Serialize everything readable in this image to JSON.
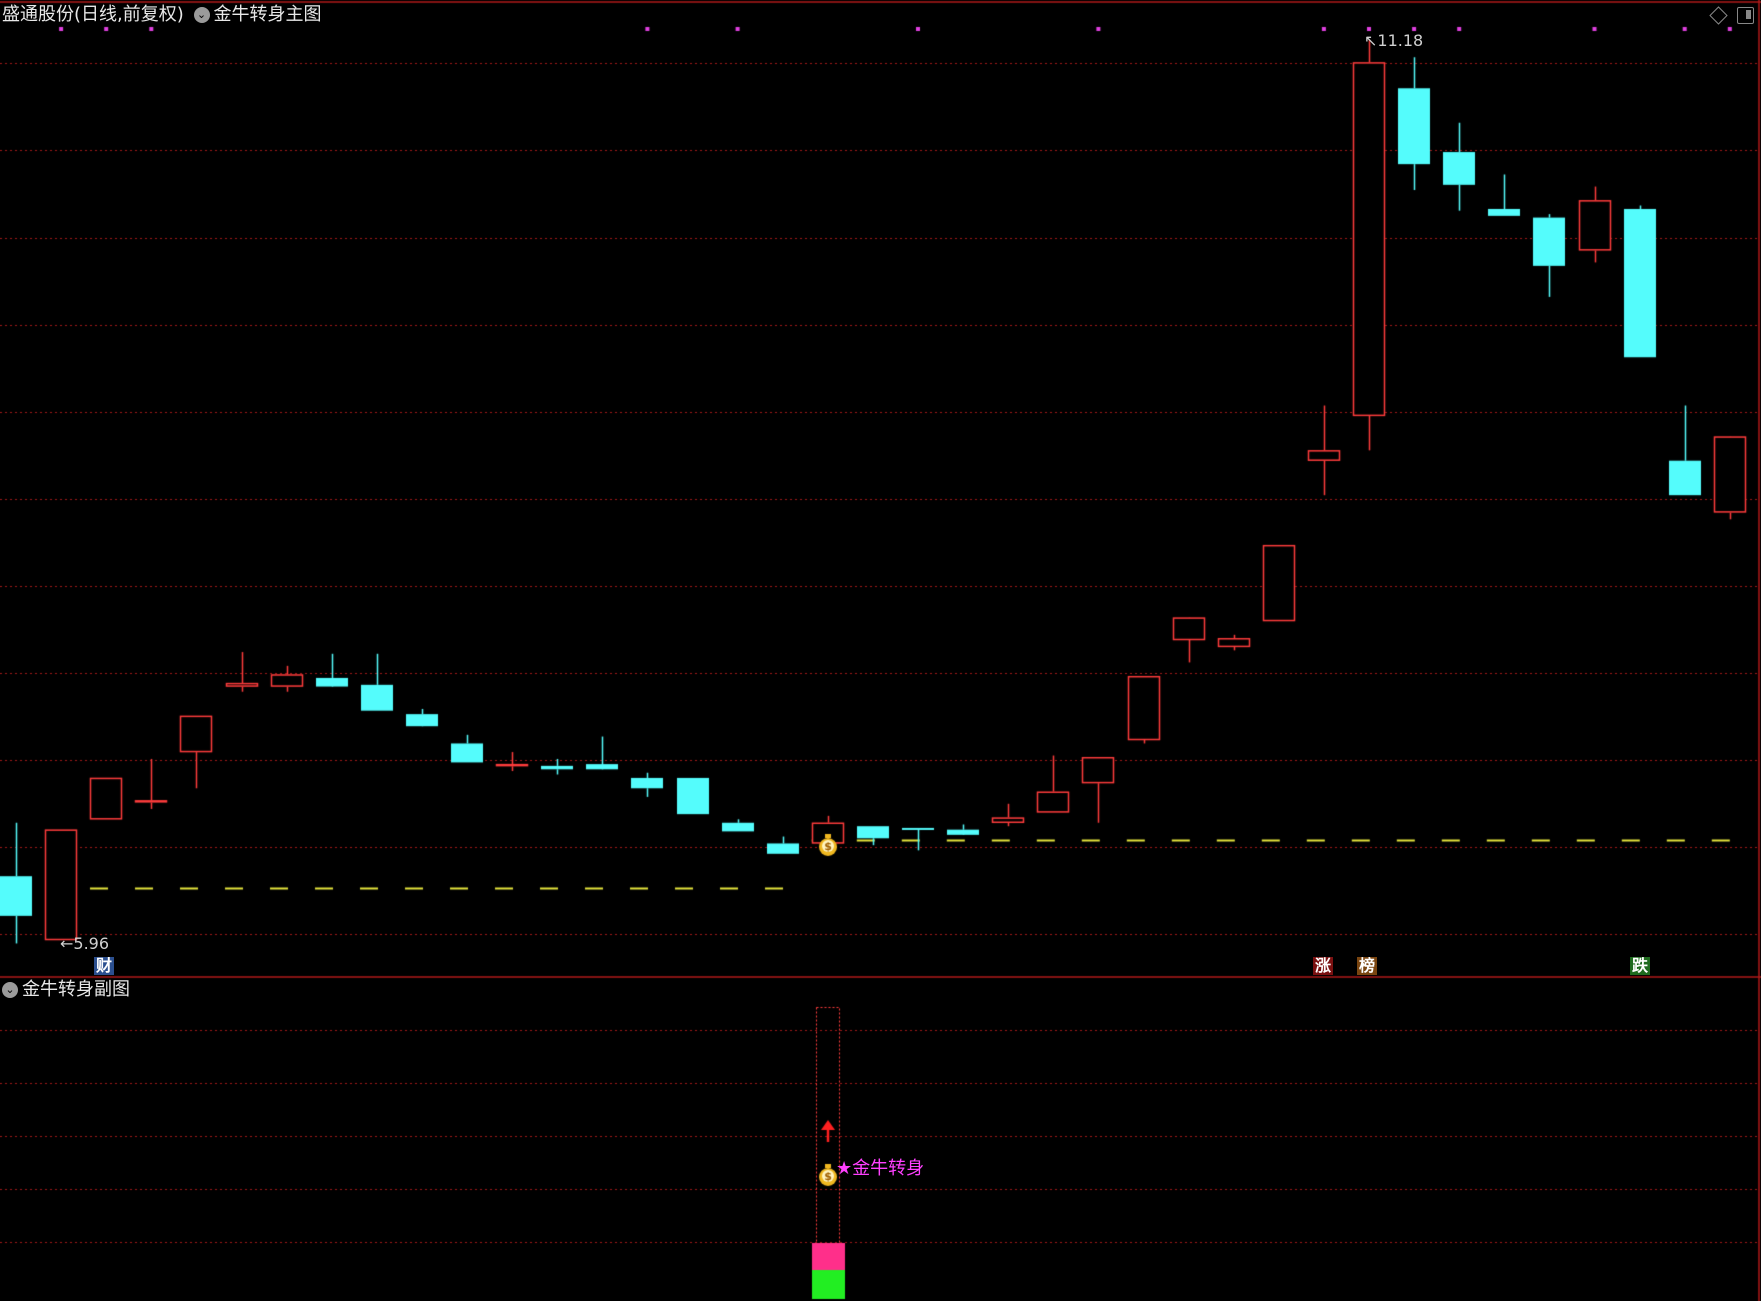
{
  "header": {
    "stock_title": "盛通股份(日线,前复权)",
    "main_indicator": "金牛转身主图",
    "sub_indicator": "金牛转身副图",
    "check_icon": "chevron-down-icon",
    "diamond_icon": "diamond-icon",
    "window_icon": "window-toggle-icon"
  },
  "labels": {
    "high_price": "11.18",
    "low_price": "5.96",
    "signal_text": "★金牛转身"
  },
  "event_markers": [
    {
      "text": "财",
      "bg": "#2b4f8f"
    },
    {
      "text": "涨",
      "bg": "#7a1010"
    },
    {
      "text": "榜",
      "bg": "#7a4510"
    },
    {
      "text": "跌",
      "bg": "#1e6a1e"
    }
  ],
  "colors": {
    "up": "#ff3c3c",
    "down": "#54fcfc",
    "grid": "#a01818",
    "support": "#e6e63c",
    "signal": "#ff40ff",
    "bar_top": "#ff2f8a",
    "bar_bottom": "#22ee22",
    "marker_dots": "#e040e0"
  },
  "chart_data": {
    "type": "candlestick",
    "price_range": [
      5.96,
      11.18
    ],
    "candles": [
      {
        "o": 6.33,
        "h": 6.64,
        "l": 5.94,
        "c": 6.1
      },
      {
        "o": 5.96,
        "h": 6.6,
        "l": 5.96,
        "c": 6.6
      },
      {
        "o": 6.66,
        "h": 6.9,
        "l": 6.66,
        "c": 6.9
      },
      {
        "o": 6.77,
        "h": 7.01,
        "l": 6.72,
        "c": 6.77
      },
      {
        "o": 7.05,
        "h": 7.26,
        "l": 6.84,
        "c": 7.26
      },
      {
        "o": 7.43,
        "h": 7.63,
        "l": 7.4,
        "c": 7.45
      },
      {
        "o": 7.43,
        "h": 7.55,
        "l": 7.4,
        "c": 7.5
      },
      {
        "o": 7.48,
        "h": 7.62,
        "l": 7.47,
        "c": 7.43
      },
      {
        "o": 7.44,
        "h": 7.62,
        "l": 7.29,
        "c": 7.29
      },
      {
        "o": 7.27,
        "h": 7.3,
        "l": 7.23,
        "c": 7.2
      },
      {
        "o": 7.1,
        "h": 7.15,
        "l": 6.99,
        "c": 6.99
      },
      {
        "o": 6.98,
        "h": 7.05,
        "l": 6.94,
        "c": 6.98
      },
      {
        "o": 6.97,
        "h": 7.01,
        "l": 6.92,
        "c": 6.95
      },
      {
        "o": 6.98,
        "h": 7.14,
        "l": 6.98,
        "c": 6.95
      },
      {
        "o": 6.9,
        "h": 6.93,
        "l": 6.79,
        "c": 6.84
      },
      {
        "o": 6.9,
        "h": 6.9,
        "l": 6.69,
        "c": 6.69
      },
      {
        "o": 6.64,
        "h": 6.66,
        "l": 6.59,
        "c": 6.59
      },
      {
        "o": 6.52,
        "h": 6.56,
        "l": 6.46,
        "c": 6.46
      },
      {
        "o": 6.52,
        "h": 6.68,
        "l": 6.49,
        "c": 6.64
      },
      {
        "o": 6.62,
        "h": 6.62,
        "l": 6.51,
        "c": 6.55
      },
      {
        "o": 6.61,
        "h": 6.61,
        "l": 6.48,
        "c": 6.6
      },
      {
        "o": 6.6,
        "h": 6.63,
        "l": 6.59,
        "c": 6.57
      },
      {
        "o": 6.64,
        "h": 6.75,
        "l": 6.62,
        "c": 6.67
      },
      {
        "o": 6.7,
        "h": 7.03,
        "l": 6.7,
        "c": 6.82
      },
      {
        "o": 6.87,
        "h": 7.01,
        "l": 6.64,
        "c": 7.02
      },
      {
        "o": 7.12,
        "h": 7.49,
        "l": 7.1,
        "c": 7.49
      },
      {
        "o": 7.7,
        "h": 7.8,
        "l": 7.57,
        "c": 7.83
      },
      {
        "o": 7.66,
        "h": 7.73,
        "l": 7.64,
        "c": 7.71
      },
      {
        "o": 7.81,
        "h": 8.25,
        "l": 7.81,
        "c": 8.25
      },
      {
        "o": 8.74,
        "h": 9.06,
        "l": 8.54,
        "c": 8.8
      },
      {
        "o": 9.0,
        "h": 11.18,
        "l": 8.8,
        "c": 11.05
      },
      {
        "o": 10.9,
        "h": 11.08,
        "l": 10.31,
        "c": 10.46
      },
      {
        "o": 10.53,
        "h": 10.7,
        "l": 10.19,
        "c": 10.34
      },
      {
        "o": 10.2,
        "h": 10.4,
        "l": 10.16,
        "c": 10.16
      },
      {
        "o": 10.15,
        "h": 10.17,
        "l": 9.69,
        "c": 9.87
      },
      {
        "o": 9.96,
        "h": 10.33,
        "l": 9.89,
        "c": 10.25
      },
      {
        "o": 10.2,
        "h": 10.22,
        "l": 9.34,
        "c": 9.34
      },
      {
        "o": 8.74,
        "h": 9.06,
        "l": 8.54,
        "c": 8.54
      },
      {
        "o": 8.44,
        "h": 8.87,
        "l": 8.4,
        "c": 8.88
      }
    ],
    "support_levels": [
      {
        "price": 6.26,
        "from_index": 0,
        "to_index": 17
      },
      {
        "price": 6.54,
        "from_index": 18,
        "to_index": 38
      }
    ],
    "signal_index": 18
  }
}
